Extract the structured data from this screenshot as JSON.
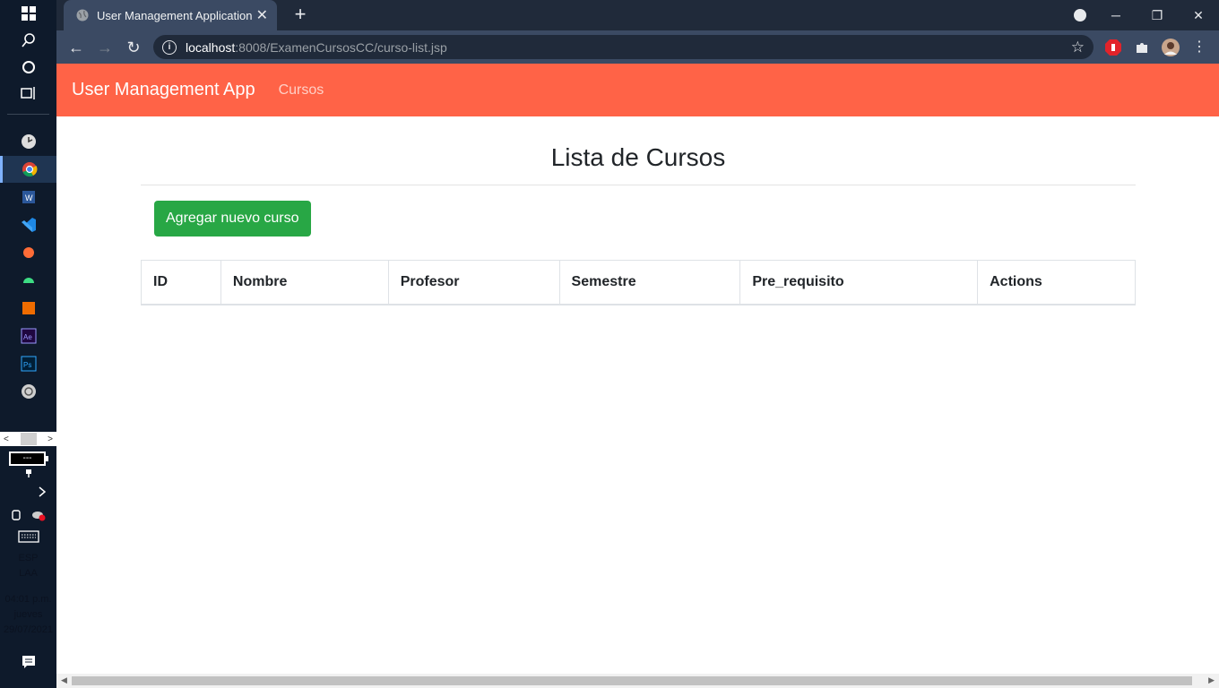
{
  "browser": {
    "tab_title": "User Management Application",
    "url_host": "localhost",
    "url_path": ":8008/ExamenCursosCC/curso-list.jsp"
  },
  "taskbar": {
    "language": "ESP",
    "layout": "LAA",
    "time": "04:01 p.m.",
    "day": "jueves",
    "date": "29/07/2021",
    "battery_text": "---"
  },
  "navbar": {
    "brand": "User Management App",
    "link": "Cursos"
  },
  "main": {
    "title": "Lista de Cursos",
    "add_button": "Agregar nuevo curso",
    "table": {
      "columns": [
        "ID",
        "Nombre",
        "Profesor",
        "Semestre",
        "Pre_requisito",
        "Actions"
      ],
      "rows": []
    }
  },
  "colors": {
    "navbar": "#ff6347",
    "success": "#28a745"
  }
}
